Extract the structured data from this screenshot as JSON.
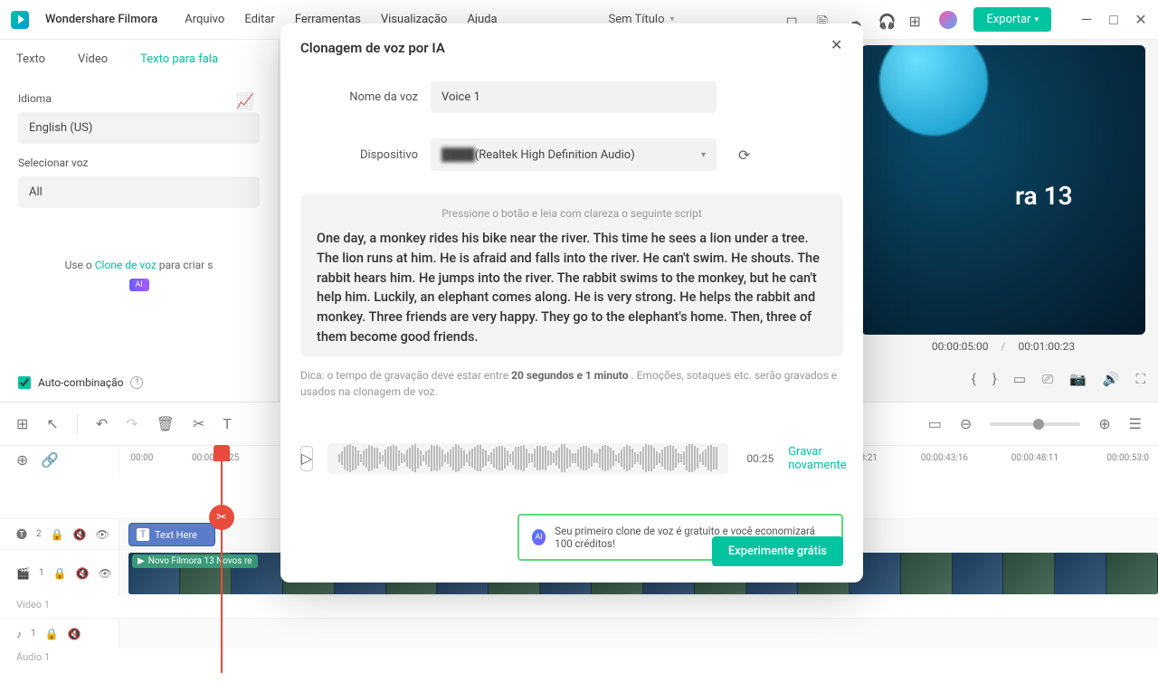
{
  "app": {
    "name": "Wondershare Filmora"
  },
  "menu": [
    "Arquivo",
    "Editar",
    "Ferramentas",
    "Visualização",
    "Ajuda"
  ],
  "project_title": "Sem Título",
  "export_label": "Exportar",
  "left": {
    "tabs": [
      "Texto",
      "Vídeo",
      "Texto para fala"
    ],
    "active_tab": 2,
    "language_label": "Idioma",
    "language_value": "English (US)",
    "voice_label": "Selecionar voz",
    "voice_value": "All",
    "clone_hint_prefix": "Use o ",
    "clone_hint_link": "Clone de voz",
    "clone_hint_suffix": " para criar s",
    "ai_badge": "AI",
    "auto_combo": "Auto-combinação"
  },
  "preview": {
    "brand_text": "ra 13",
    "current_time": "00:00:05:00",
    "total_time": "00:01:00:23"
  },
  "timeline": {
    "ruler": [
      ":00:00",
      "00:00:04:25"
    ],
    "ruler_far": [
      "3:21",
      "00:00:43:16",
      "00:00:48:11",
      "00:00:53:0"
    ],
    "text_clip": "Text Here",
    "video_clip": "Novo Filmora 13 Novos re",
    "track_video_label": "Vídeo 1",
    "track_audio_label": "Áudio 1"
  },
  "modal": {
    "title": "Clonagem de voz por IA",
    "voice_name_label": "Nome da voz",
    "voice_name_value": "Voice 1",
    "device_label": "Dispositivo",
    "device_masked": "████",
    "device_suffix": "(Realtek High Definition Audio)",
    "script_hint": "Pressione o botão e leia com clareza o seguinte script",
    "script_text": "One day, a monkey rides his bike near the river. This time he sees a lion under a tree. The lion runs at him. He is afraid and falls into the river. He can't swim. He shouts. The rabbit hears him. He jumps into the river. The rabbit swims to the monkey, but he can't help him. Luckily, an elephant comes along. He is very strong. He helps the rabbit and monkey. Three friends are very happy. They go to the elephant's home. Then, three of them become good friends.",
    "tip_prefix": "Dica: o tempo de gravação deve estar entre ",
    "tip_bold": "20 segundos e 1 minuto",
    "tip_suffix": " . Emoções, sotaques etc. serão gravados e usados na clonagem de voz.",
    "rec_time": "00:25",
    "rec_again": "Gravar novamente",
    "credit_text": "Seu primeiro clone de voz é gratuito e você economizará 100 créditos!",
    "try_free": "Experimente grátis"
  }
}
